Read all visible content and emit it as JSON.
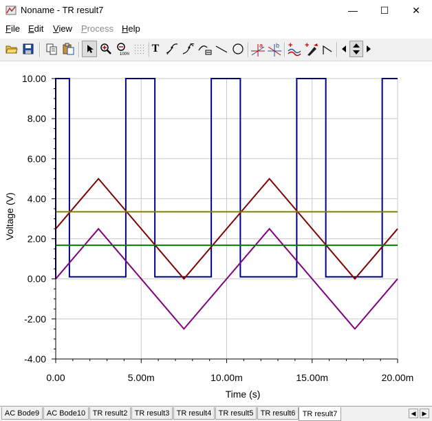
{
  "window": {
    "title": "Noname - TR result7",
    "minimize_glyph": "—",
    "maximize_glyph": "☐",
    "close_glyph": "✕"
  },
  "menu": {
    "items": [
      {
        "label": "File",
        "mnemonic": "F",
        "rest": "ile",
        "enabled": true
      },
      {
        "label": "Edit",
        "mnemonic": "E",
        "rest": "dit",
        "enabled": true
      },
      {
        "label": "View",
        "mnemonic": "V",
        "rest": "iew",
        "enabled": true
      },
      {
        "label": "Process",
        "mnemonic": "P",
        "rest": "rocess",
        "enabled": false
      },
      {
        "label": "Help",
        "mnemonic": "H",
        "rest": "elp",
        "enabled": true
      }
    ]
  },
  "toolbar": {
    "icons": [
      "open-icon",
      "save-icon",
      "copy-icon",
      "paste-icon",
      "select-arrow-icon",
      "zoom-in-icon",
      "zoom-100-icon",
      "grid-icon",
      "text-tool-icon",
      "curve-tool-a-icon",
      "curve-tool-b-icon",
      "curve-tool-c-icon",
      "line-tool-icon",
      "circle-tool-icon",
      "cursor-a-icon",
      "cursor-b-icon",
      "add-curve-icon",
      "marker-icon",
      "polyline-icon",
      "step-left-icon",
      "step-updown-icon",
      "step-right-icon"
    ],
    "text_tool_glyph": "T",
    "cursor_a_label": "a",
    "cursor_b_label": "b"
  },
  "tabs": {
    "items": [
      "AC Bode9",
      "AC Bode10",
      "TR result2",
      "TR result3",
      "TR result4",
      "TR result5",
      "TR result6",
      "TR result7"
    ],
    "active": "TR result7",
    "left_arrow": "◀",
    "right_arrow": "▶"
  },
  "chart_data": {
    "type": "line",
    "xlabel": "Time (s)",
    "ylabel": "Voltage (V)",
    "xlim": [
      0,
      0.02
    ],
    "ylim": [
      -4,
      10
    ],
    "xticks": [
      {
        "value": 0,
        "label": "0.00"
      },
      {
        "value": 0.005,
        "label": "5.00m"
      },
      {
        "value": 0.01,
        "label": "10.00m"
      },
      {
        "value": 0.015,
        "label": "15.00m"
      },
      {
        "value": 0.02,
        "label": "20.00m"
      }
    ],
    "yticks": [
      {
        "value": 10,
        "label": "10.00"
      },
      {
        "value": 8,
        "label": "8.00"
      },
      {
        "value": 6,
        "label": "6.00"
      },
      {
        "value": 4,
        "label": "4.00"
      },
      {
        "value": 2,
        "label": "2.00"
      },
      {
        "value": 0,
        "label": "0.00"
      },
      {
        "value": -2,
        "label": "-2.00"
      },
      {
        "value": -4,
        "label": "-4.00"
      }
    ],
    "grid": true,
    "series": [
      {
        "color": "#000080",
        "x": [
          0,
          0,
          0.0008,
          0.0008,
          0.0041,
          0.0041,
          0.0058,
          0.0058,
          0.0091,
          0.0091,
          0.0108,
          0.0108,
          0.0141,
          0.0141,
          0.0158,
          0.0158,
          0.0191,
          0.0191,
          0.02
        ],
        "y": [
          0,
          10,
          10,
          0.1,
          0.1,
          10,
          10,
          0.1,
          0.1,
          10,
          10,
          0.1,
          0.1,
          10,
          10,
          0.1,
          0.1,
          10,
          10
        ]
      },
      {
        "color": "#800000",
        "x": [
          0,
          0.0025,
          0.0075,
          0.0125,
          0.0175,
          0.02
        ],
        "y": [
          2.5,
          5,
          0,
          5,
          0,
          2.5
        ]
      },
      {
        "color": "#800080",
        "x": [
          0,
          0.0025,
          0.0075,
          0.0125,
          0.0175,
          0.02
        ],
        "y": [
          0,
          2.5,
          -2.5,
          2.5,
          -2.5,
          0
        ]
      },
      {
        "color": "#808000",
        "x": [
          0,
          0.02
        ],
        "y": [
          3.35,
          3.35
        ]
      },
      {
        "color": "#008000",
        "x": [
          0,
          0.02
        ],
        "y": [
          1.68,
          1.68
        ]
      }
    ]
  }
}
